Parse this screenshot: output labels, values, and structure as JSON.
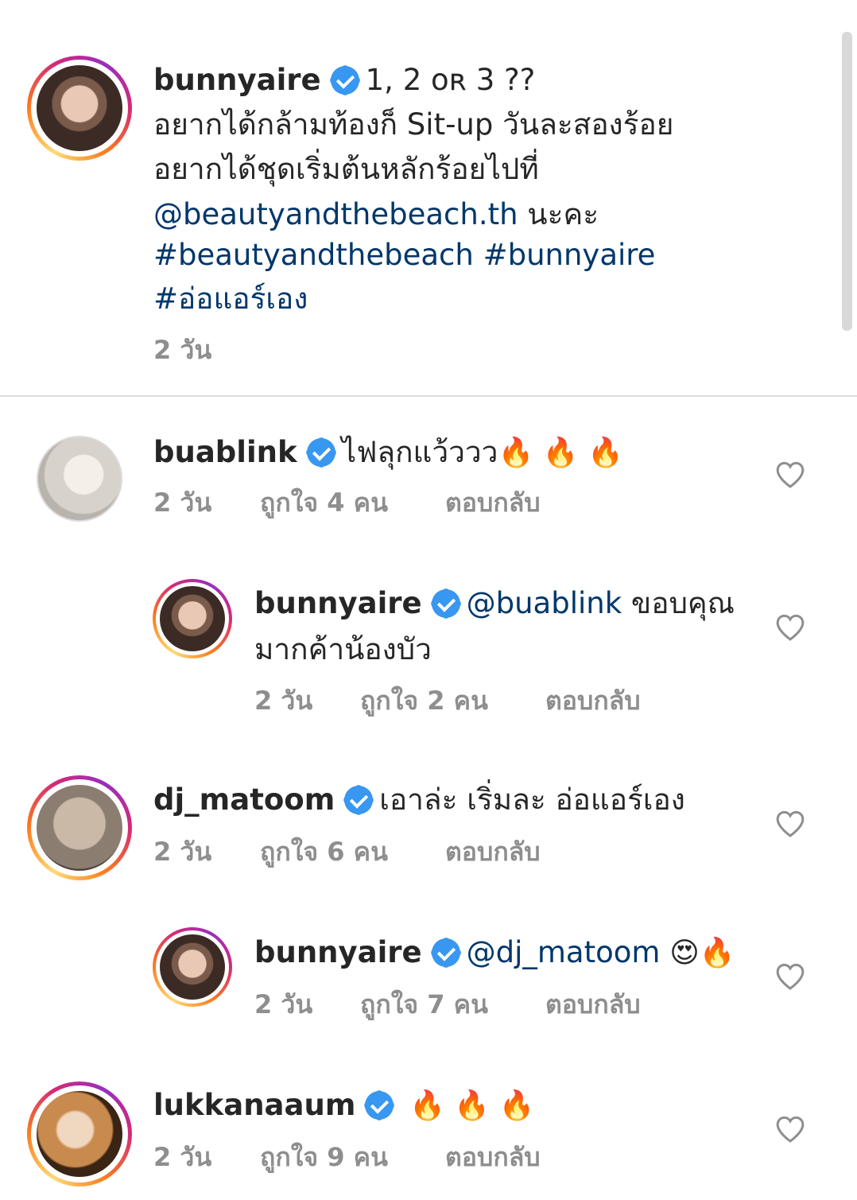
{
  "caption": {
    "username": "bunnyaire",
    "title_text": "1, 2 ᴏʀ 3 ??",
    "lines": [
      "อยากได้กล้ามท้องก็ Sit-up วันละสองร้อย",
      "อยากได้ชุดเริ่มต้นหลักร้อยไปที่"
    ],
    "mention": "@beautyandthebeach.th",
    "mention_suffix": " นะคะ",
    "hashtags_1": "#beautyandthebeach #bunnyaire",
    "hashtags_2": "#อ่อแอร์เอง",
    "time": "2 วัน"
  },
  "comments": [
    {
      "username": "buablink",
      "text": "ไฟลุกแว้ววว",
      "emoji": "🔥 🔥 🔥",
      "time": "2 วัน",
      "likes": "ถูกใจ 4 คน",
      "reply": "ตอบกลับ"
    },
    {
      "username": "bunnyaire",
      "mention": "@buablink",
      "text": " ขอบคุณ",
      "text2": "มากค้าน้องบัว",
      "time": "2 วัน",
      "likes": "ถูกใจ 2 คน",
      "reply": "ตอบกลับ"
    },
    {
      "username": "dj_matoom",
      "text": "เอาล่ะ เริ่มละ อ่อแอร์เอง",
      "time": "2 วัน",
      "likes": "ถูกใจ 6 คน",
      "reply": "ตอบกลับ"
    },
    {
      "username": "bunnyaire",
      "mention": "@dj_matoom",
      "emoji": "😍🔥",
      "time": "2 วัน",
      "likes": "ถูกใจ 7 คน",
      "reply": "ตอบกลับ"
    },
    {
      "username": "lukkanaaum",
      "emoji": "🔥 🔥 🔥",
      "time": "2 วัน",
      "likes": "ถูกใจ 9 คน",
      "reply": "ตอบกลับ"
    }
  ],
  "colors": {
    "link": "#00376b",
    "verified": "#3897f0",
    "meta": "#8e8e8e"
  }
}
